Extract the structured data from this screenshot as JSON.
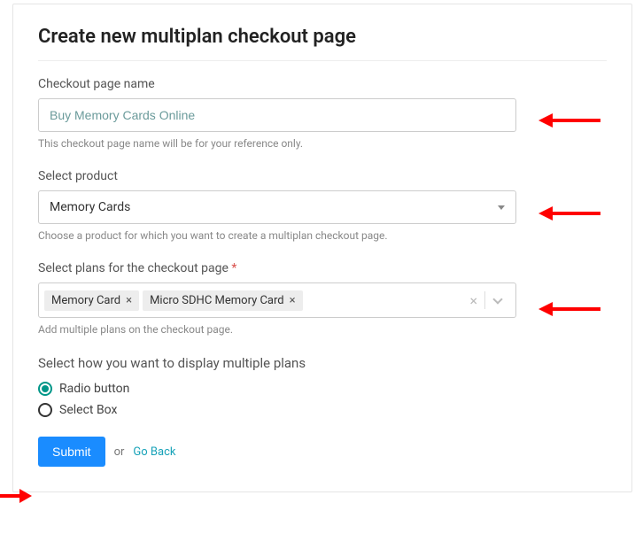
{
  "title": "Create new multiplan checkout page",
  "name_field": {
    "label": "Checkout page name",
    "value": "Buy Memory Cards Online",
    "help": "This checkout page name will be for your reference only."
  },
  "product_field": {
    "label": "Select product",
    "value": "Memory Cards",
    "help": "Choose a product for which you want to create a multiplan checkout page."
  },
  "plans_field": {
    "label": "Select plans for the checkout page",
    "required_mark": "*",
    "tags": [
      "Memory Card",
      "Micro SDHC Memory Card"
    ],
    "help": "Add multiple plans on the checkout page."
  },
  "display_field": {
    "label": "Select how you want to display multiple plans",
    "options": [
      "Radio button",
      "Select Box"
    ],
    "selected_index": 0
  },
  "actions": {
    "submit": "Submit",
    "or": "or",
    "go_back": "Go Back"
  }
}
